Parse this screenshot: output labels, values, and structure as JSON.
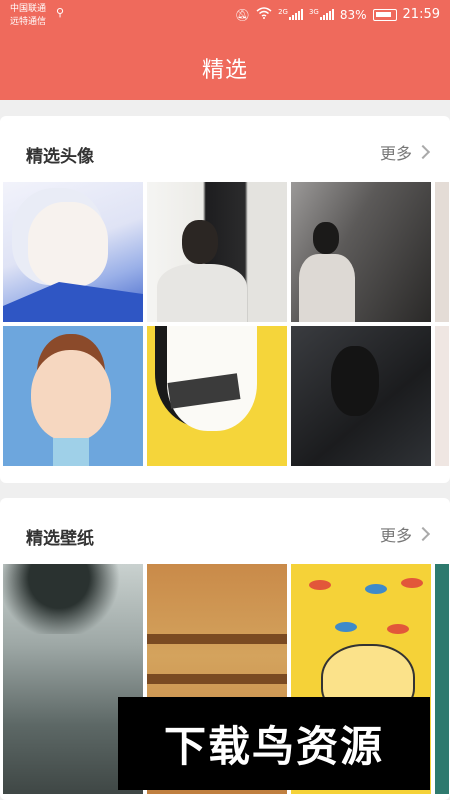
{
  "status_bar": {
    "carrier_line1": "中国联通",
    "carrier_line2": "远特通信",
    "network1": "2G",
    "network2": "3G",
    "battery": "83%",
    "time": "21:59"
  },
  "header": {
    "title": "精选"
  },
  "sections": [
    {
      "title": "精选头像",
      "more_label": "更多"
    },
    {
      "title": "精选壁纸",
      "more_label": "更多"
    }
  ],
  "watermark": {
    "text": "下载鸟资源"
  },
  "colors": {
    "accent": "#ef6a5c",
    "background": "#efefef"
  }
}
